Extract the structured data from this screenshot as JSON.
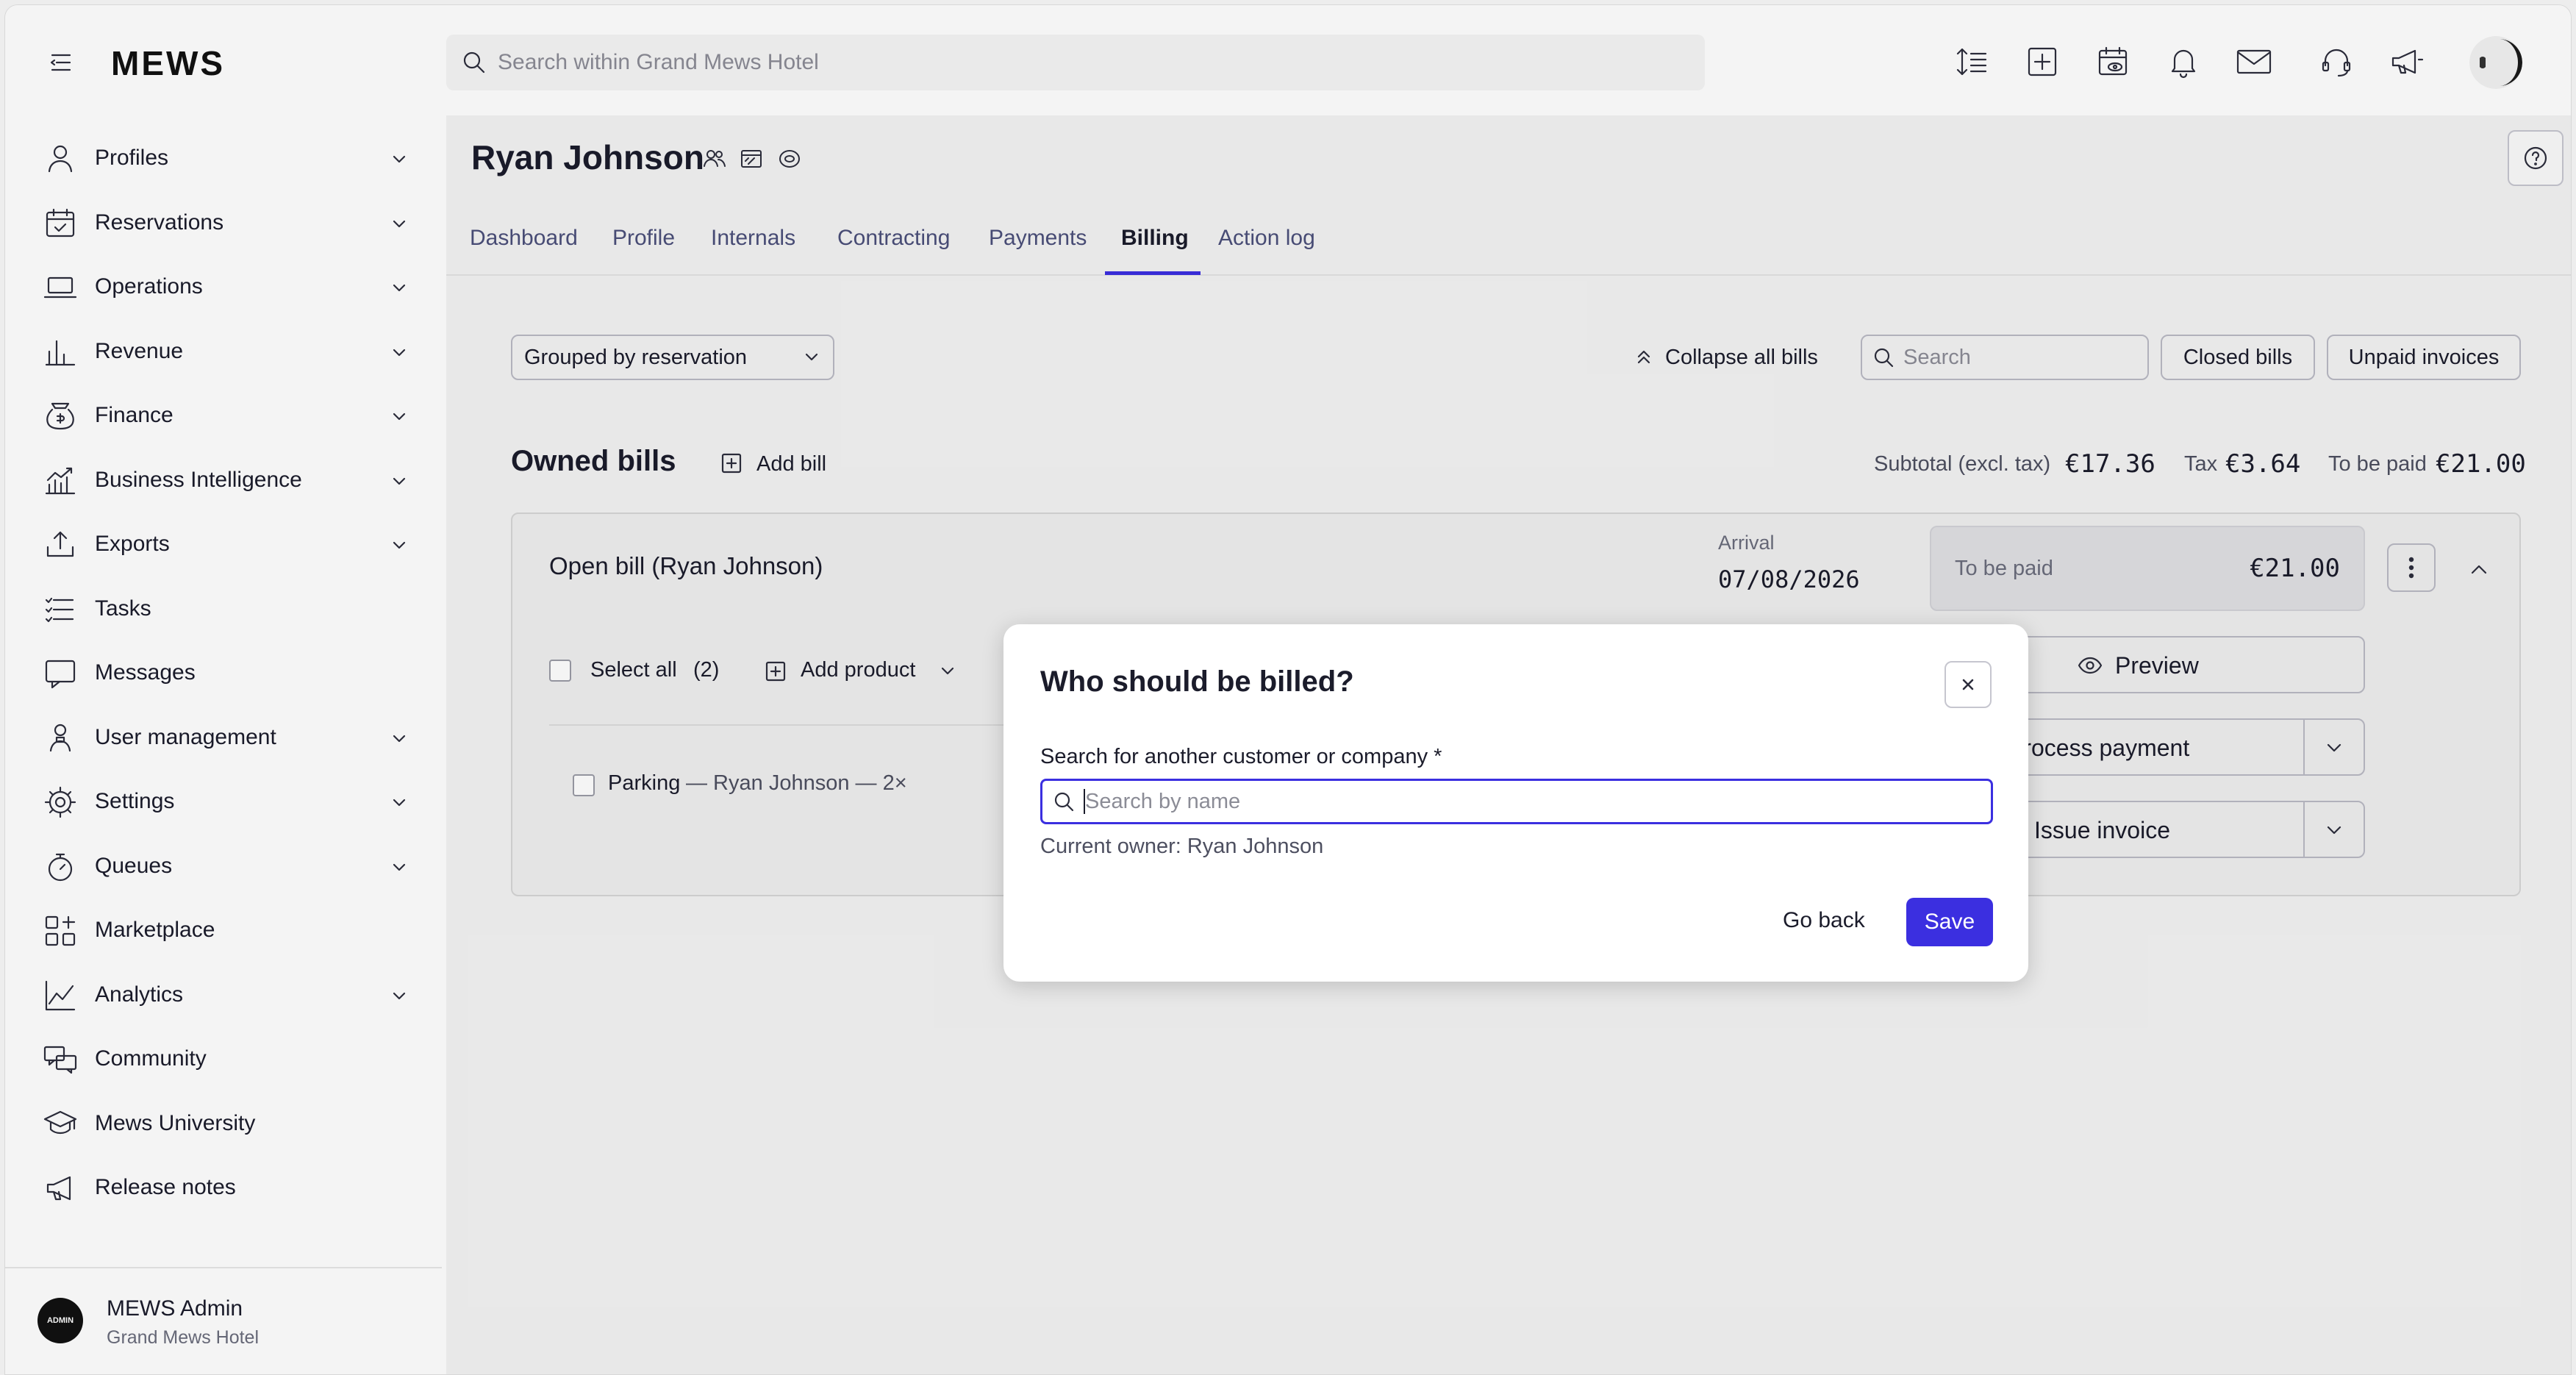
{
  "app": {
    "logo": "MEWS"
  },
  "topbar": {
    "search_placeholder": "Search within Grand Mews Hotel",
    "icons": [
      "sort-icon",
      "add-icon",
      "calendar-view-icon",
      "bell-icon",
      "mail-icon",
      "support-icon",
      "announcement-icon",
      "avatar"
    ]
  },
  "sidebar": {
    "items": [
      {
        "label": "Profiles",
        "chevron": true
      },
      {
        "label": "Reservations",
        "chevron": true
      },
      {
        "label": "Operations",
        "chevron": true
      },
      {
        "label": "Revenue",
        "chevron": true
      },
      {
        "label": "Finance",
        "chevron": true
      },
      {
        "label": "Business Intelligence",
        "chevron": true
      },
      {
        "label": "Exports",
        "chevron": true
      },
      {
        "label": "Tasks",
        "chevron": false
      },
      {
        "label": "Messages",
        "chevron": false
      },
      {
        "label": "User management",
        "chevron": true
      },
      {
        "label": "Settings",
        "chevron": true
      },
      {
        "label": "Queues",
        "chevron": true
      },
      {
        "label": "Marketplace",
        "chevron": false
      },
      {
        "label": "Analytics",
        "chevron": true
      },
      {
        "label": "Community",
        "chevron": false
      },
      {
        "label": "Mews University",
        "chevron": false
      },
      {
        "label": "Release notes",
        "chevron": false
      }
    ],
    "user": {
      "badge": "ADMIN",
      "name": "MEWS Admin",
      "property": "Grand Mews Hotel"
    }
  },
  "profile": {
    "name": "Ryan Johnson",
    "tabs": [
      "Dashboard",
      "Profile",
      "Internals",
      "Contracting",
      "Payments",
      "Billing",
      "Action log"
    ],
    "active_tab": "Billing"
  },
  "billing": {
    "grouping": "Grouped by reservation",
    "collapse_label": "Collapse all bills",
    "search_placeholder": "Search",
    "closed_bills": "Closed bills",
    "unpaid_invoices": "Unpaid invoices",
    "owned_bills_title": "Owned bills",
    "add_bill": "Add bill",
    "subtotal_label": "Subtotal (excl. tax)",
    "subtotal_value": "€17.36",
    "tax_label": "Tax",
    "tax_value": "€3.64",
    "to_be_paid_label": "To be paid",
    "to_be_paid_value": "€21.00"
  },
  "bill": {
    "title": "Open bill (Ryan Johnson)",
    "arrival_label": "Arrival",
    "arrival_date": "07/08/2026",
    "to_be_paid_label": "To be paid",
    "to_be_paid_value": "€21.00",
    "select_all": "Select all",
    "select_count": "(2)",
    "add_product": "Add product",
    "preview": "Preview",
    "process_payment": "Process payment",
    "issue_invoice": "Issue invoice",
    "line_item": "Parking",
    "line_item_detail": "— Ryan Johnson — 2×"
  },
  "modal": {
    "title": "Who should be billed?",
    "field_label": "Search for another customer or company *",
    "placeholder": "Search by name",
    "current_owner": "Current owner: Ryan Johnson",
    "go_back": "Go back",
    "save": "Save"
  },
  "colors": {
    "accent": "#3b2fe0",
    "tab_underline": "#3b2fe0",
    "text": "#1b1c2b"
  }
}
